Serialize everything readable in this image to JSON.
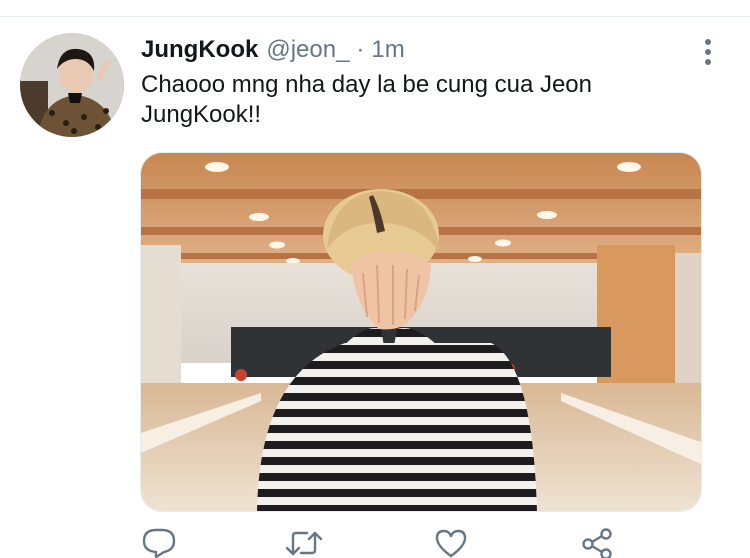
{
  "tweet": {
    "display_name": "JungKook",
    "handle": "@jeon_",
    "separator": "·",
    "timestamp": "1m",
    "text": "Chaooo mng nha day la be cung cua Jeon JungKook!!"
  },
  "icons": {
    "more": "more-vertical-icon",
    "reply": "reply-icon",
    "retweet": "retweet-icon",
    "like": "heart-icon",
    "share": "share-icon"
  },
  "colors": {
    "text_primary": "#14171a",
    "text_secondary": "#657786",
    "icon": "#657786",
    "divider": "#e6ecf0"
  }
}
